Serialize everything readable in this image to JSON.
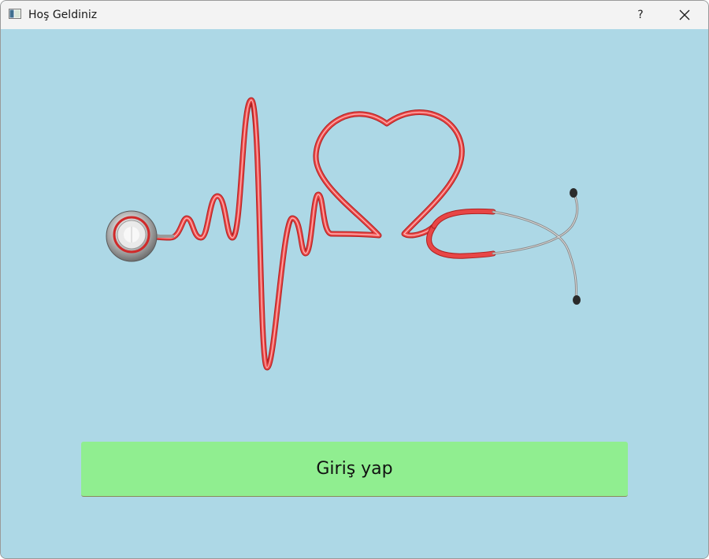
{
  "window": {
    "title": "Hoş Geldiniz",
    "help_label": "?",
    "close_label": "✕"
  },
  "main": {
    "login_button_label": "Giriş yap",
    "illustration_icon": "stethoscope-heartbeat-icon"
  },
  "colors": {
    "background": "#add8e6",
    "button": "#90ee90",
    "tube": "#e03a3a",
    "titlebar": "#f3f3f3"
  }
}
